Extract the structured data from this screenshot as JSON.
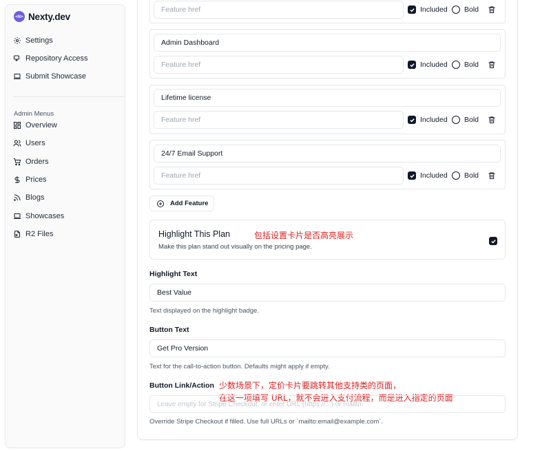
{
  "brand": {
    "logo_text": "<N>",
    "name": "Nexty.dev",
    "accent": "#6d5ce8"
  },
  "sidebar": {
    "items": [
      {
        "label": "Settings",
        "icon": "gear-icon"
      },
      {
        "label": "Repository Access",
        "icon": "key-icon"
      },
      {
        "label": "Submit Showcase",
        "icon": "laptop-icon"
      }
    ],
    "section_label": "Admin Menus",
    "admin_items": [
      {
        "label": "Overview",
        "icon": "dashboard-icon"
      },
      {
        "label": "Users",
        "icon": "users-icon"
      },
      {
        "label": "Orders",
        "icon": "cart-icon"
      },
      {
        "label": "Prices",
        "icon": "dollar-icon"
      },
      {
        "label": "Blogs",
        "icon": "rss-icon"
      },
      {
        "label": "Showcases",
        "icon": "laptop-icon"
      },
      {
        "label": "R2 Files",
        "icon": "files-icon"
      }
    ]
  },
  "features": {
    "href_placeholder": "Feature href",
    "included_label": "Included",
    "bold_label": "Bold",
    "items": [
      {
        "name": "",
        "included": true,
        "bold": false
      },
      {
        "name": "Admin Dashboard",
        "included": true,
        "bold": false
      },
      {
        "name": "Lifetime license",
        "included": true,
        "bold": false
      },
      {
        "name": "24/7 Email Support",
        "included": true,
        "bold": false
      }
    ],
    "add_label": "Add Feature"
  },
  "highlight": {
    "title": "Highlight This Plan",
    "description": "Make this plan stand out visually on the pricing page.",
    "checked": true,
    "annotation": "包括设置卡片是否高亮展示"
  },
  "highlight_text": {
    "label": "Highlight Text",
    "value": "Best Value",
    "help": "Text displayed on the highlight badge."
  },
  "button_text": {
    "label": "Button Text",
    "value": "Get Pro Version",
    "help": "Text for the call-to-action button. Defaults might apply if empty."
  },
  "button_link": {
    "label": "Button Link/Action",
    "placeholder": "Leave empty for Stripe Checkout, or enter URL (https://...) or mailto:",
    "help": "Override Stripe Checkout if filled. Use full URLs or `mailto:email@example.com`.",
    "annotation_line1": "少数场景下，定价卡片要跳转其他支持类的页面，",
    "annotation_line2": "在这一项填写 URL，就不会进入支付流程，而是进入指定的页面"
  },
  "colors": {
    "annotation": "#e02020",
    "checkbox": "#111827",
    "border": "#e5e7eb"
  }
}
